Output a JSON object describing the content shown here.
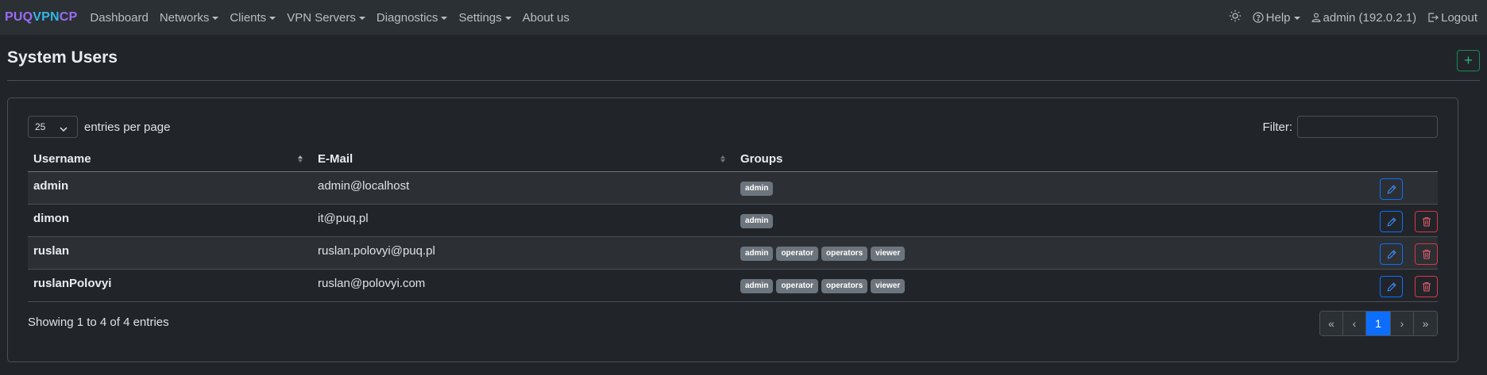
{
  "brand": {
    "part1": "PUQ",
    "part2": "VPN",
    "part3": "CP"
  },
  "nav": {
    "items": [
      {
        "label": "Dashboard",
        "dropdown": false
      },
      {
        "label": "Networks",
        "dropdown": true
      },
      {
        "label": "Clients",
        "dropdown": true
      },
      {
        "label": "VPN Servers",
        "dropdown": true
      },
      {
        "label": "Diagnostics",
        "dropdown": true
      },
      {
        "label": "Settings",
        "dropdown": true
      },
      {
        "label": "About us",
        "dropdown": false
      }
    ],
    "help_label": "Help",
    "user_label": "admin (192.0.2.1)",
    "logout_label": "Logout"
  },
  "page": {
    "title": "System Users",
    "add_button": "+"
  },
  "table_controls": {
    "per_page_value": "25",
    "per_page_label": "entries per page",
    "filter_label": "Filter:"
  },
  "table": {
    "columns": [
      "Username",
      "E-Mail",
      "Groups"
    ],
    "rows": [
      {
        "username": "admin",
        "email": "admin@localhost",
        "groups": [
          "admin"
        ],
        "deletable": false
      },
      {
        "username": "dimon",
        "email": "it@puq.pl",
        "groups": [
          "admin"
        ],
        "deletable": true
      },
      {
        "username": "ruslan",
        "email": "ruslan.polovyi@puq.pl",
        "groups": [
          "admin",
          "operator",
          "operators",
          "viewer"
        ],
        "deletable": true
      },
      {
        "username": "ruslanPolovyi",
        "email": "ruslan@polovyi.com",
        "groups": [
          "admin",
          "operator",
          "operators",
          "viewer"
        ],
        "deletable": true
      }
    ]
  },
  "footer": {
    "info": "Showing 1 to 4 of 4 entries",
    "pagination": [
      "«",
      "‹",
      "1",
      "›",
      "»"
    ],
    "current_page": "1"
  },
  "colors": {
    "accent": "#0d6efd",
    "danger": "#dc3545",
    "success": "#198754",
    "badge": "#6c757d"
  }
}
